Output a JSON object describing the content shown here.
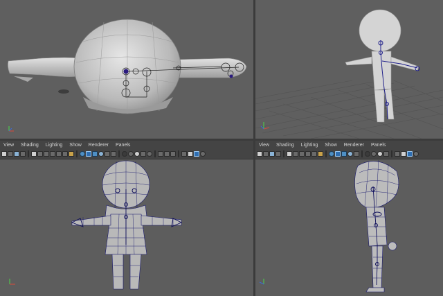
{
  "panels": [
    {
      "id": "top",
      "menus": [
        "View",
        "Shading",
        "Lighting",
        "Show",
        "Renderer",
        "Panels"
      ],
      "show_menu": false
    },
    {
      "id": "persp",
      "menus": [
        "View",
        "Shading",
        "Lighting",
        "Show",
        "Renderer",
        "Panels"
      ],
      "show_menu": false
    },
    {
      "id": "front",
      "menus": [
        "View",
        "Shading",
        "Lighting",
        "Show",
        "Renderer",
        "Panels"
      ],
      "show_menu": true
    },
    {
      "id": "side",
      "menus": [
        "View",
        "Shading",
        "Lighting",
        "Show",
        "Renderer",
        "Panels"
      ],
      "show_menu": true
    }
  ],
  "menu_front": {
    "view": "View",
    "shading": "Shading",
    "lighting": "Lighting",
    "show": "Show",
    "renderer": "Renderer",
    "panels": "Panels"
  },
  "menu_side": {
    "view": "View",
    "shading": "Shading",
    "lighting": "Lighting",
    "show": "Show",
    "renderer": "Renderer",
    "panels": "Panels"
  },
  "colors": {
    "viewport_bg": "#5f5f5f",
    "mesh_shaded": "#c8c8c8",
    "wire": "#1a1a6e",
    "joint": "#1f1f8a",
    "grid": "#4d4d4d",
    "axis_x": "#d94a3a",
    "axis_y": "#4ad94a",
    "axis_z": "#3a6ad9"
  },
  "icons": [
    "select-icon",
    "lasso-icon",
    "paint-icon",
    "camera-icon",
    "grid-icon",
    "wireframe-icon",
    "smooth-shade-icon",
    "texture-icon",
    "light-icon",
    "shadow-icon",
    "xray-icon",
    "isolate-icon"
  ]
}
